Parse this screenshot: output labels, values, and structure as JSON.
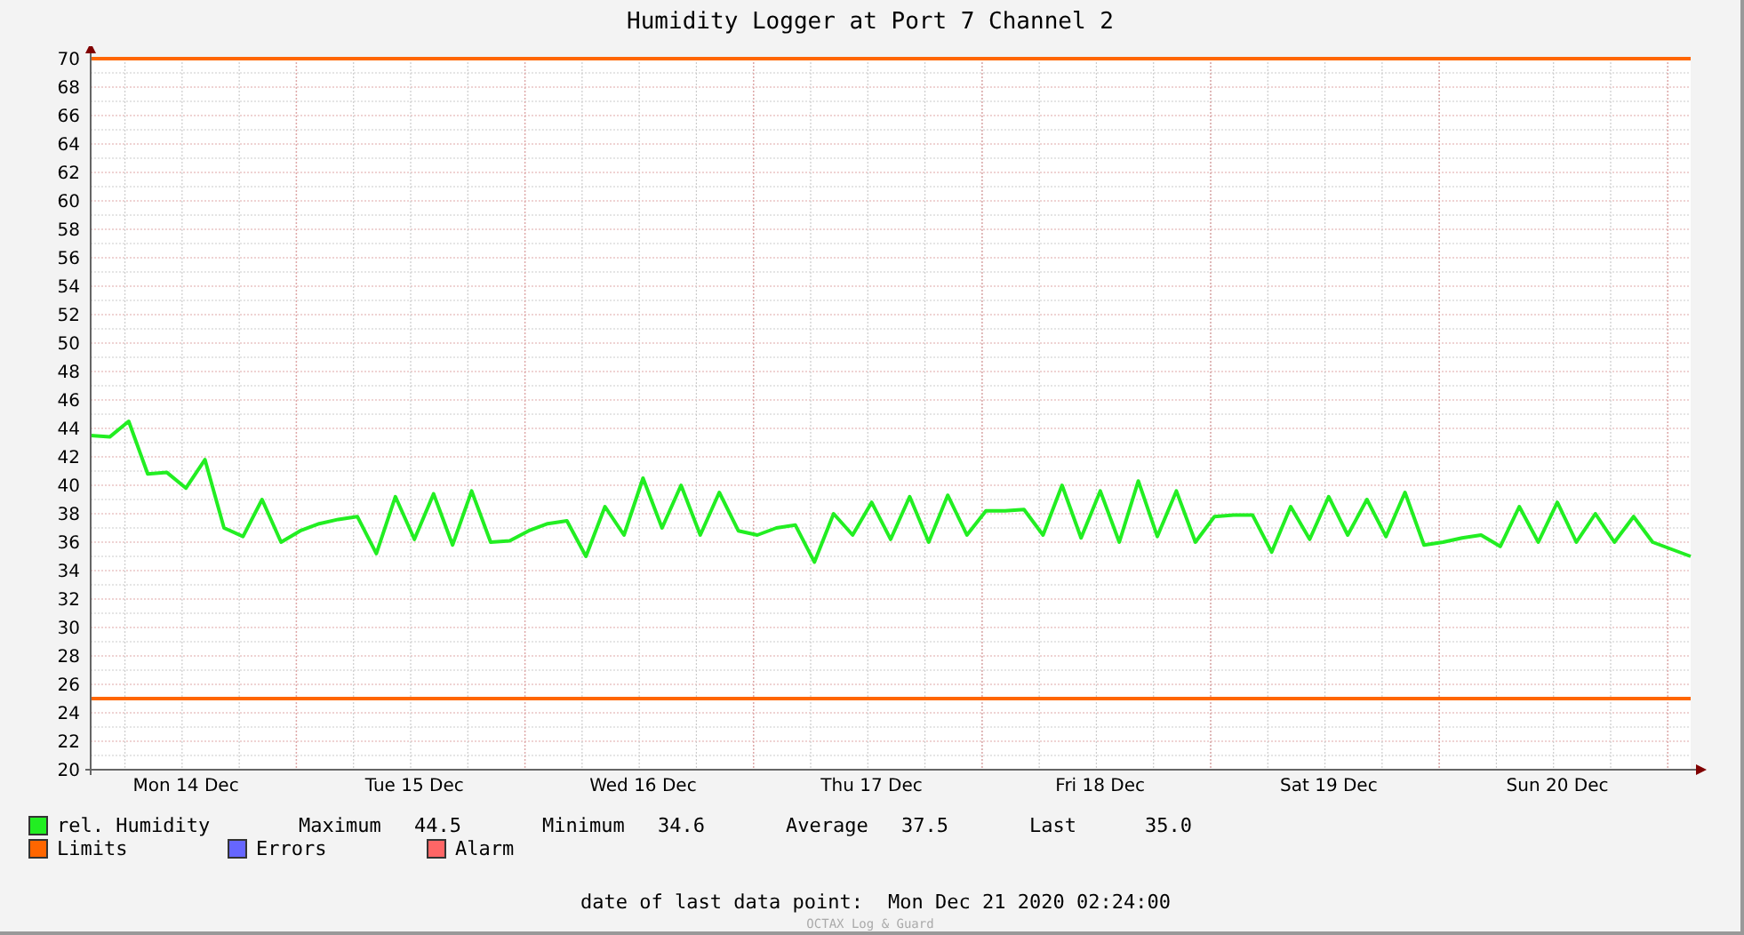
{
  "chart_data": {
    "type": "line",
    "title": "Humidity Logger at Port 7 Channel 2",
    "categories": [
      null,
      null,
      null,
      null,
      null,
      "Mon 14 Dec",
      null,
      null,
      null,
      null,
      null,
      null,
      null,
      null,
      null,
      null,
      null,
      "Tue 15 Dec",
      null,
      null,
      null,
      null,
      null,
      null,
      null,
      null,
      null,
      null,
      null,
      "Wed 16 Dec",
      null,
      null,
      null,
      null,
      null,
      null,
      null,
      null,
      null,
      null,
      null,
      "Thu 17 Dec",
      null,
      null,
      null,
      null,
      null,
      null,
      null,
      null,
      null,
      null,
      null,
      "Fri 18 Dec",
      null,
      null,
      null,
      null,
      null,
      null,
      null,
      null,
      null,
      null,
      null,
      "Sat 19 Dec",
      null,
      null,
      null,
      null,
      null,
      null,
      null,
      null,
      null,
      null,
      null,
      "Sun 20 Dec",
      null,
      null,
      null,
      null,
      null,
      null,
      null
    ],
    "series": [
      {
        "name": "rel. Humidity",
        "color": "#22ee22",
        "values": [
          43.5,
          43.4,
          44.5,
          40.8,
          40.9,
          39.8,
          41.8,
          37,
          36.4,
          39,
          36,
          36.8,
          37.3,
          37.6,
          37.8,
          35.2,
          39.2,
          36.2,
          39.4,
          35.8,
          39.6,
          36,
          36.1,
          36.8,
          37.3,
          37.5,
          35,
          38.5,
          36.5,
          40.5,
          37,
          40,
          36.5,
          39.5,
          36.8,
          36.5,
          37,
          37.2,
          34.6,
          38,
          36.5,
          38.8,
          36.2,
          39.2,
          36,
          39.3,
          36.5,
          38.2,
          38.2,
          38.3,
          36.5,
          40,
          36.3,
          39.6,
          36,
          40.3,
          36.4,
          39.6,
          36,
          37.8,
          37.9,
          37.9,
          35.3,
          38.5,
          36.2,
          39.2,
          36.5,
          39,
          36.4,
          39.5,
          35.8,
          36,
          36.3,
          36.5,
          35.7,
          38.5,
          36,
          38.8,
          36,
          38,
          36,
          37.8,
          36,
          35.5,
          35.0
        ]
      }
    ],
    "ylim": [
      20,
      70
    ],
    "yticks": [
      20,
      22,
      24,
      26,
      28,
      30,
      32,
      34,
      36,
      38,
      40,
      42,
      44,
      46,
      48,
      50,
      52,
      54,
      56,
      58,
      60,
      62,
      64,
      66,
      68,
      70
    ],
    "grid": true,
    "ref_lines": [
      {
        "axis": "y",
        "value": 70,
        "color": "#ff6600"
      },
      {
        "axis": "y",
        "value": 25,
        "color": "#ff6600"
      }
    ]
  },
  "legend": {
    "stats": [
      {
        "label": "Maximum",
        "value": "44.5"
      },
      {
        "label": "Minimum",
        "value": "34.6"
      },
      {
        "label": "Average",
        "value": "37.5"
      },
      {
        "label": "Last",
        "value": "35.0"
      }
    ],
    "others": [
      {
        "label": "Limits",
        "color": "#ff6600"
      },
      {
        "label": "Errors",
        "color": "#6666ff"
      },
      {
        "label": "Alarm",
        "color": "#ff6666"
      }
    ]
  },
  "footer": {
    "label": "date of last data point:",
    "value": "Mon Dec 21 2020 02:24:00"
  },
  "credit": "OCTAX Log & Guard"
}
